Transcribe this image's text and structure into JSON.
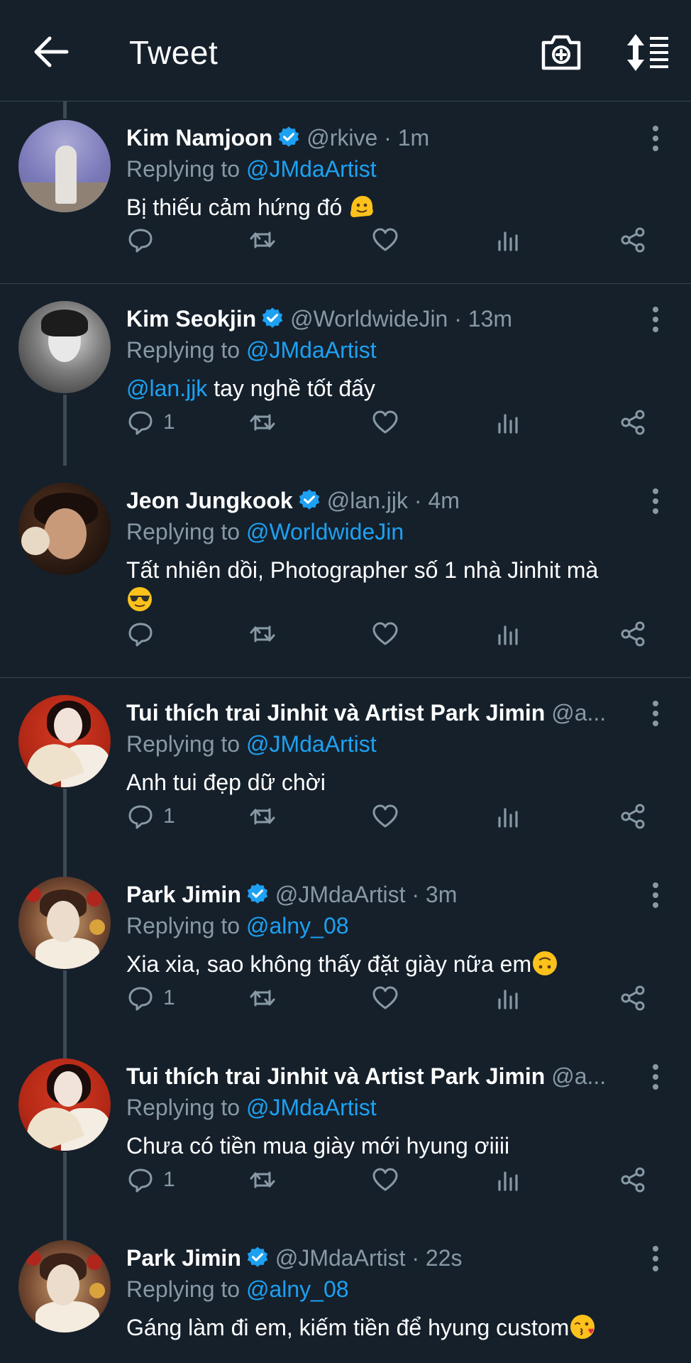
{
  "header": {
    "title": "Tweet",
    "back_icon": "arrow-left-icon",
    "camera_icon": "camera-plus-icon",
    "sort_icon": "sort-order-icon"
  },
  "colors": {
    "background": "#15202b",
    "divider": "#38444d",
    "secondary_text": "#8899a6",
    "link": "#1da1f2",
    "verified": "#1da1f2"
  },
  "tweets": [
    {
      "display_name": "Kim Namjoon",
      "verified": true,
      "meta": "@rkive · 1m",
      "replying_prefix": "Replying to",
      "replying_to": "@JMdaArtist",
      "text": "Bị thiếu cảm hứng đó",
      "emoji": "melting-face-emoji",
      "reply_count": ""
    },
    {
      "display_name": "Kim Seokjin",
      "verified": true,
      "meta": "@WorldwideJin · 13m",
      "replying_prefix": "Replying to",
      "replying_to": "@JMdaArtist",
      "mention": "@lan.jjk",
      "text": " tay nghề tốt đấy",
      "reply_count": "1"
    },
    {
      "display_name": "Jeon Jungkook",
      "verified": true,
      "meta": "@lan.jjk · 4m",
      "replying_prefix": "Replying to",
      "replying_to": "@WorldwideJin",
      "text": "Tất nhiên dồi, Photographer số 1 nhà Jinhit mà",
      "emoji": "sunglasses-emoji",
      "reply_count": ""
    },
    {
      "display_name": "Tui thích trai Jinhit và Artist Park Jimin",
      "verified": false,
      "meta": "@a...",
      "replying_prefix": "Replying to",
      "replying_to": "@JMdaArtist",
      "text": "Anh tui đẹp dữ chời",
      "reply_count": "1"
    },
    {
      "display_name": "Park Jimin",
      "verified": true,
      "meta": "@JMdaArtist · 3m",
      "replying_prefix": "Replying to",
      "replying_to": "@alny_08",
      "text": "Xia xia, sao không thấy đặt giày nữa em",
      "emoji": "upside-down-face-emoji",
      "reply_count": "1"
    },
    {
      "display_name": "Tui thích trai Jinhit và Artist Park Jimin",
      "verified": false,
      "meta": "@a...",
      "replying_prefix": "Replying to",
      "replying_to": "@JMdaArtist",
      "text": "Chưa có tiền mua giày mới hyung ơiiii",
      "reply_count": "1"
    },
    {
      "display_name": "Park Jimin",
      "verified": true,
      "meta": "@JMdaArtist · 22s",
      "replying_prefix": "Replying to",
      "replying_to": "@alny_08",
      "text": "Gáng làm đi em, kiếm tiền để hyung custom",
      "emoji": "face-blowing-kiss-emoji",
      "reply_count": ""
    }
  ]
}
